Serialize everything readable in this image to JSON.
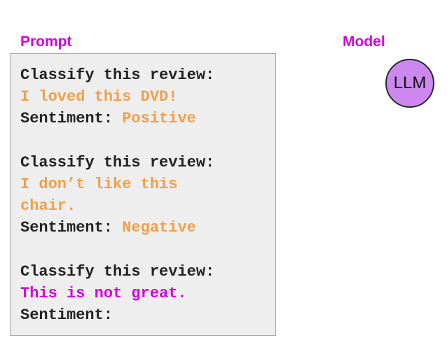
{
  "labels": {
    "prompt": "Prompt",
    "model": "Model"
  },
  "prompt": {
    "example1": {
      "instruction": "Classify this review:",
      "review": "I loved this DVD!",
      "sentiment_prefix": "Sentiment: ",
      "sentiment_value": "Positive"
    },
    "example2": {
      "instruction": "Classify this review:",
      "review_line1": "I don’t like this",
      "review_line2": "chair.",
      "sentiment_prefix": "Sentiment: ",
      "sentiment_value": "Negative"
    },
    "query": {
      "instruction": "Classify this review:",
      "review": "This is not great.",
      "sentiment_prefix": "Sentiment:"
    }
  },
  "model": {
    "name": "LLM"
  },
  "colors": {
    "label": "#d400e0",
    "example_text": "#f0a04b",
    "query_text": "#d400e0",
    "llm_fill": "#cc88ee",
    "box_fill": "#eeeeee"
  }
}
